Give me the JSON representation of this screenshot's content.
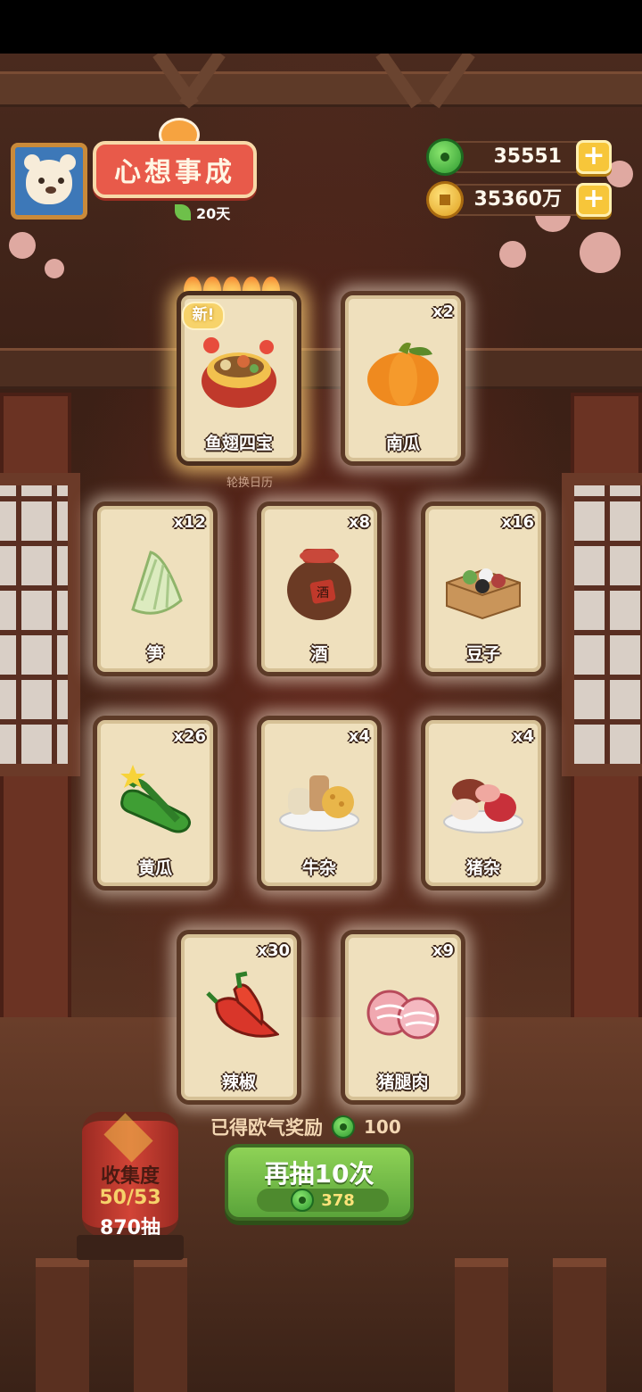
{
  "header": {
    "title": "心想事成",
    "days": "20天",
    "jade_amount": "35551",
    "coin_amount": "35360万"
  },
  "calendar_label": "轮换日历",
  "new_badge": "新!",
  "cards": [
    {
      "name": "鱼翅四宝",
      "count": "",
      "icon": "soup-pot-icon"
    },
    {
      "name": "南瓜",
      "count": "x2",
      "icon": "pumpkin-icon"
    },
    {
      "name": "笋",
      "count": "x12",
      "icon": "bamboo-shoot-icon"
    },
    {
      "name": "酒",
      "count": "x8",
      "icon": "wine-jar-icon"
    },
    {
      "name": "豆子",
      "count": "x16",
      "icon": "beans-box-icon"
    },
    {
      "name": "黄瓜",
      "count": "x26",
      "icon": "cucumber-icon"
    },
    {
      "name": "牛杂",
      "count": "x4",
      "icon": "beef-offal-icon"
    },
    {
      "name": "猪杂",
      "count": "x4",
      "icon": "pork-offal-icon"
    },
    {
      "name": "辣椒",
      "count": "x30",
      "icon": "chili-icon"
    },
    {
      "name": "猪腿肉",
      "count": "x9",
      "icon": "pork-leg-icon"
    }
  ],
  "collection": {
    "label": "收集度",
    "progress": "50/53",
    "draws": "870抽"
  },
  "lucky_reward": {
    "label": "已得欧气奖励",
    "value": "100"
  },
  "draw_button": {
    "label": "再抽10次",
    "cost": "378"
  },
  "colors": {
    "button_green": "#6fbb46",
    "card_bg": "#efe0bd",
    "title_red": "#e85a4a"
  }
}
